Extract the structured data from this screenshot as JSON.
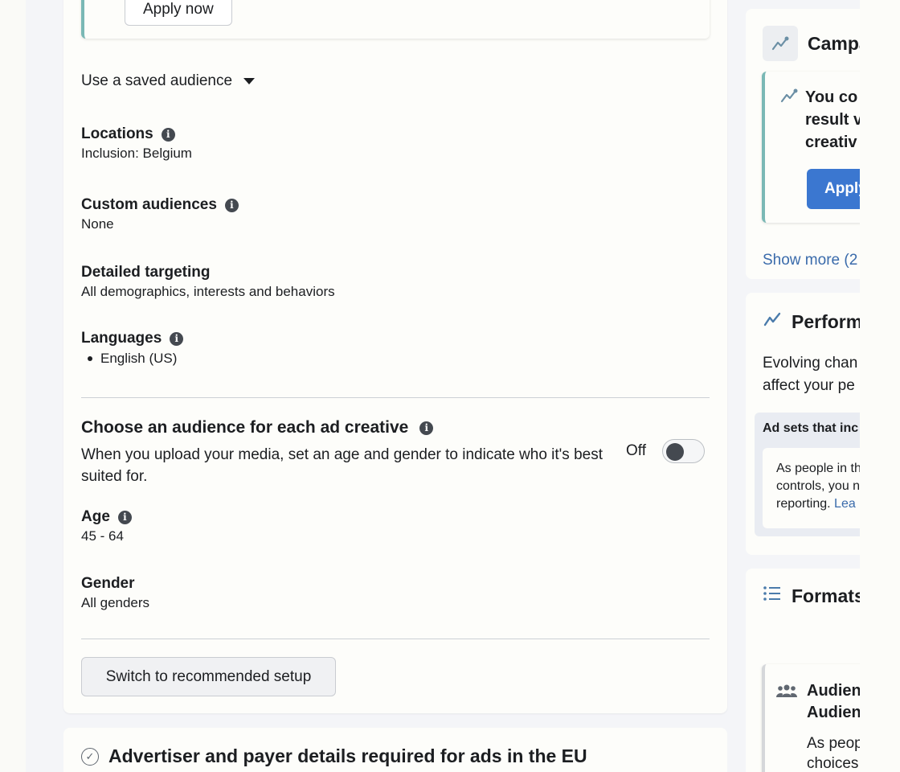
{
  "recommendation": {
    "apply_label": "Apply now"
  },
  "audience": {
    "saved_audience_label": "Use a saved audience",
    "locations": {
      "label": "Locations",
      "value": "Inclusion: Belgium"
    },
    "custom_audiences": {
      "label": "Custom audiences",
      "value": "None"
    },
    "detailed_targeting": {
      "label": "Detailed targeting",
      "value": "All demographics, interests and behaviors"
    },
    "languages": {
      "label": "Languages",
      "items": [
        "English (US)"
      ]
    },
    "choose_audience": {
      "title": "Choose an audience for each ad creative",
      "description": "When you upload your media, set an age and gender to indicate who it's best suited for.",
      "toggle_state": "Off"
    },
    "age": {
      "label": "Age",
      "value": "45 - 64"
    },
    "gender": {
      "label": "Gender",
      "value": "All genders"
    },
    "switch_label": "Switch to recommended setup"
  },
  "eu_section": {
    "title": "Advertiser and payer details required for ads in the EU"
  },
  "sidebar": {
    "campaign": {
      "title": "Campa",
      "tip_lines": [
        "You co",
        "result v",
        "creativ"
      ],
      "apply_label": "Apply",
      "show_more": "Show more (2"
    },
    "performance": {
      "title": "Perform",
      "text_lines": [
        "Evolving chan",
        "affect your pe"
      ],
      "adsets_title": "Ad sets that inc",
      "adsets_lines": [
        "As people in th",
        "controls, you n",
        "reporting."
      ],
      "adsets_link": "Lea"
    },
    "formats": {
      "title": "Formats",
      "audience_title_lines": [
        "Audien",
        "Audien"
      ],
      "audience_text_lines": [
        "As peop",
        "choices"
      ]
    }
  },
  "icons": {
    "info": "info-icon",
    "caret": "caret-down-icon",
    "check": "check-circle-icon",
    "trend": "trend-line-icon",
    "list": "list-icon",
    "people": "people-icon"
  },
  "colors": {
    "accent_teal": "#7ab8b5",
    "primary_blue": "#3b77d0",
    "link_blue": "#3a6bab"
  }
}
